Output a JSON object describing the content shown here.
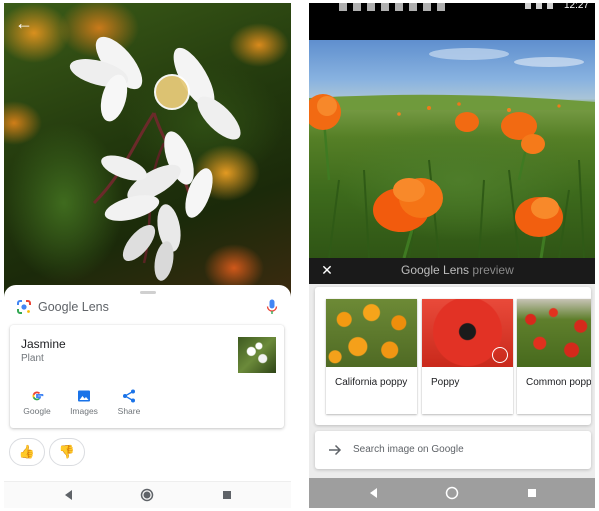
{
  "left_phone": {
    "back_label": "←",
    "lens_title": "Google Lens",
    "result": {
      "name": "Jasmine",
      "type": "Plant"
    },
    "actions": [
      {
        "label": "Google",
        "icon": "google-g-icon"
      },
      {
        "label": "Images",
        "icon": "image-icon"
      },
      {
        "label": "Share",
        "icon": "share-icon"
      }
    ],
    "feedback": {
      "up": "👍",
      "down": "👎"
    },
    "nav": [
      "back-triangle-icon",
      "home-circle-icon",
      "recents-square-icon"
    ]
  },
  "right_phone": {
    "status_time": "12:27",
    "lens_bar": {
      "close": "✕",
      "title": "Google Lens",
      "subtitle": "preview"
    },
    "results": [
      {
        "label": "California poppy"
      },
      {
        "label": "Poppy"
      },
      {
        "label": "Common poppy"
      }
    ],
    "search_text": "Search image on Google",
    "nav": [
      "back-triangle-icon",
      "home-circle-icon",
      "recents-square-icon"
    ]
  },
  "colors": {
    "google_blue": "#4285f4",
    "google_red": "#ea4335",
    "google_yellow": "#fbbc05",
    "google_green": "#34a853",
    "accent_blue": "#1a73e8"
  }
}
